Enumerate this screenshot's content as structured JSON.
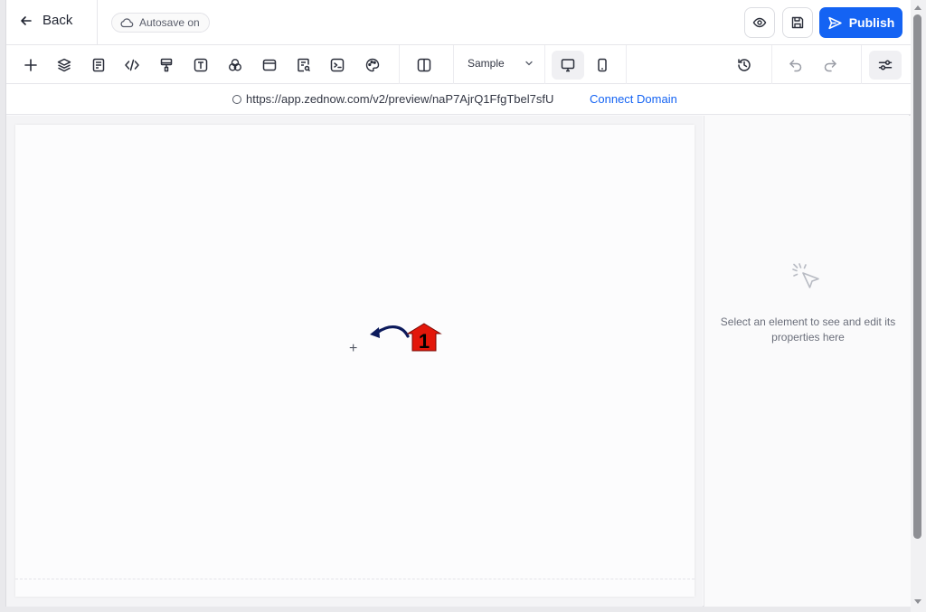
{
  "header": {
    "back_label": "Back",
    "autosave_label": "Autosave on",
    "publish_label": "Publish"
  },
  "toolbar": {
    "sample_label": "Sample"
  },
  "urlbar": {
    "url": "https://app.zednow.com/v2/preview/naP7AjrQ1FfgTbel7sfU",
    "connect_label": "Connect Domain"
  },
  "canvas": {
    "annotation_number": "1"
  },
  "sidepanel": {
    "hint": "Select an element to see and edit its properties here"
  },
  "colors": {
    "accent": "#1463f3",
    "annotation_red": "#e3170a",
    "annotation_arrow": "#0c1a5c"
  },
  "icons": [
    "arrow-left-icon",
    "cloud-icon",
    "eye-icon",
    "save-icon",
    "send-icon",
    "plus-icon",
    "layers-icon",
    "page-icon",
    "code-icon",
    "paint-roller-icon",
    "text-icon",
    "circles-icon",
    "card-icon",
    "search-doc-icon",
    "terminal-icon",
    "palette-icon",
    "columns-icon",
    "chevron-down-icon",
    "desktop-icon",
    "mobile-icon",
    "history-icon",
    "undo-icon",
    "redo-icon",
    "sliders-icon",
    "cursor-click-icon"
  ]
}
